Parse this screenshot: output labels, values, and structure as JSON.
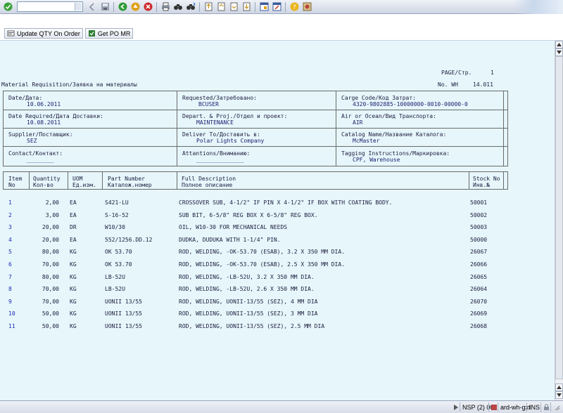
{
  "toolbar": {
    "command_field_value": "",
    "icons": [
      "enter-icon",
      "save-icon",
      "back-icon",
      "exit-icon",
      "cancel-icon",
      "print-icon",
      "find-icon",
      "find-next-icon",
      "first-page-icon",
      "prev-page-icon",
      "next-page-icon",
      "last-page-icon",
      "new-session-icon",
      "shortcut-icon",
      "help-icon",
      "layout-icon"
    ]
  },
  "app_toolbar": {
    "buttons": [
      {
        "label": "Update QTY On Order",
        "icon": "update-qty-icon"
      },
      {
        "label": "Get PO MR",
        "icon": "get-po-icon"
      }
    ]
  },
  "report": {
    "page_label": "PAGE/Стр.",
    "page_value": "1",
    "title": "Material Requisition/Заявка на материалы",
    "no_label": "No. WH",
    "no_value": "14.011",
    "header_fields": {
      "date_label": "Date/Дата:",
      "date_value": "10.06.2011",
      "requested_label": "Requested/Затребовано:",
      "requested_value": "BCUSER",
      "charge_label": "Carge Code/Код Затрат:",
      "charge_value": "4320-9802885-10000000-0010-00000-0",
      "date_req_label": "Date Required/Дата Доставки:",
      "date_req_value": "10.08.2011",
      "depart_label": "Depart. & Proj./Отдел и проект:",
      "depart_value": "MAINTENANCE",
      "transport_label": "Air or Ocean/Вид Транспорта:",
      "transport_value": "AIR",
      "supplier_label": "Supplier/Поставщик:",
      "supplier_value": "SEZ",
      "deliver_label": "Deliver To/Доставить в:",
      "deliver_value": "Polar Lights Company",
      "catalog_label": "Catalog Name/Название Каталога:",
      "catalog_value": "McMaster",
      "contact_label": "Contact/Контакт:",
      "contact_value": "________",
      "attention_label": "Attantions/Вниманию:",
      "attention_value": "______________",
      "tagging_label": "Tagging Instructions/Маркировка:",
      "tagging_value": "CPF, Warehouse"
    },
    "columns": {
      "item": [
        "Item",
        "No"
      ],
      "qty": [
        "Quantity",
        "Кол-во"
      ],
      "uom": [
        "UOM",
        "Ед.изм."
      ],
      "part": [
        "Part Number",
        "Каталож.номер"
      ],
      "desc": [
        "Full Description",
        "Полное описание"
      ],
      "stock": [
        "Stock No",
        "Инв.№"
      ]
    },
    "items": [
      {
        "no": "1",
        "qty": "2,00",
        "uom": "EA",
        "part": "S421-LU",
        "desc": "CROSSOVER SUB, 4-1/2\" IF PIN X 4-1/2\" IF BOX WITH COATING BODY.",
        "stock": "50001"
      },
      {
        "no": "2",
        "qty": "3,00",
        "uom": "EA",
        "part": "S-16-52",
        "desc": "SUB BIT, 6-5/8\" REG BOX X 6-5/8\" REG BOX.",
        "stock": "50002"
      },
      {
        "no": "3",
        "qty": "20,00",
        "uom": "DR",
        "part": "W10/30",
        "desc": "OIL, W10-30 FOR MECHANICAL NEEDS",
        "stock": "50003"
      },
      {
        "no": "4",
        "qty": "20,00",
        "uom": "EA",
        "part": "552/1256.DD.12",
        "desc": "DUDKA, DUDUKA WITH 1-1/4\" PIN.",
        "stock": "50000"
      },
      {
        "no": "5",
        "qty": "80,00",
        "uom": "KG",
        "part": "OK 53.70",
        "desc": "ROD, WELDING, -OK-53.70 (ESAB), 3.2 X 350 MM DIA.",
        "stock": "26067"
      },
      {
        "no": "6",
        "qty": "70,00",
        "uom": "KG",
        "part": "OK 53.70",
        "desc": "ROD, WELDING, -OK-53.70 (ESAB), 2.5 X 350 MM DIA.",
        "stock": "26066"
      },
      {
        "no": "7",
        "qty": "80,00",
        "uom": "KG",
        "part": "LB-52U",
        "desc": "ROD, WELDING, -LB-52U, 3.2 X 350 MM DIA.",
        "stock": "26065"
      },
      {
        "no": "8",
        "qty": "70,00",
        "uom": "KG",
        "part": "LB-52U",
        "desc": "ROD, WELDING, -LB-52U, 2.6 X 350 MM DIA.",
        "stock": "26064"
      },
      {
        "no": "9",
        "qty": "70,00",
        "uom": "KG",
        "part": "UONII 13/55",
        "desc": "ROD, WELDING, UONII-13/55 (SEZ), 4 MM DIA",
        "stock": "26070"
      },
      {
        "no": "10",
        "qty": "50,00",
        "uom": "KG",
        "part": "UONII 13/55",
        "desc": "ROD, WELDING, UONII-13/55 (SEZ), 3 MM DIA",
        "stock": "26069"
      },
      {
        "no": "11",
        "qty": "50,00",
        "uom": "KG",
        "part": "UONII 13/55",
        "desc": "ROD, WELDING, UONII-13/55 (SEZ), 2.5 MM DIA",
        "stock": "26068"
      }
    ]
  },
  "statusbar": {
    "system": "NSP (2) 000",
    "server": "ard-wh-gxt",
    "mode": "INS"
  }
}
